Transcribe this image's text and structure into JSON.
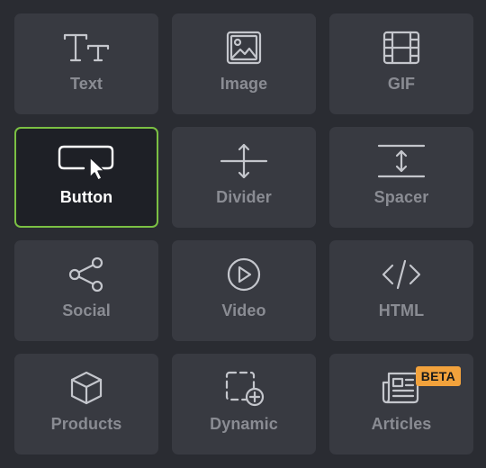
{
  "blocks": [
    {
      "label": "Text",
      "icon": "text-icon"
    },
    {
      "label": "Image",
      "icon": "image-icon"
    },
    {
      "label": "GIF",
      "icon": "film-icon"
    },
    {
      "label": "Button",
      "icon": "button-cursor-icon",
      "selected": true
    },
    {
      "label": "Divider",
      "icon": "divider-icon"
    },
    {
      "label": "Spacer",
      "icon": "spacer-icon"
    },
    {
      "label": "Social",
      "icon": "share-icon"
    },
    {
      "label": "Video",
      "icon": "play-circle-icon"
    },
    {
      "label": "HTML",
      "icon": "code-icon"
    },
    {
      "label": "Products",
      "icon": "box-icon"
    },
    {
      "label": "Dynamic",
      "icon": "dashed-add-icon"
    },
    {
      "label": "Articles",
      "icon": "newspaper-icon",
      "badge": "BETA"
    }
  ],
  "colors": {
    "selected_border": "#7bc043",
    "badge_bg": "#f2a23c"
  }
}
